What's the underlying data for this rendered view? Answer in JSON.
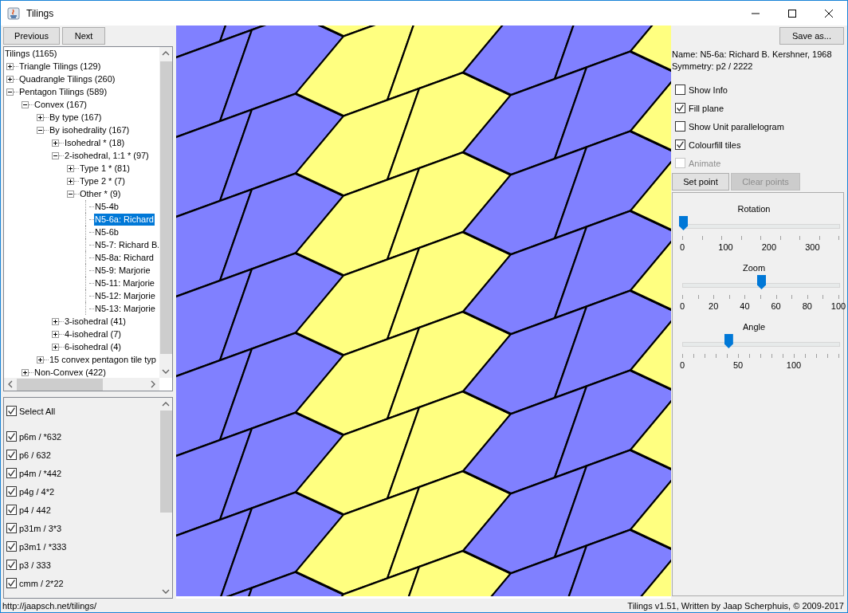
{
  "window": {
    "title": "Tilings"
  },
  "nav_buttons": [
    "Previous",
    "Next"
  ],
  "tree": {
    "root": "Tilings (1165)",
    "items": [
      {
        "label": "Triangle Tilings (129)",
        "expanded": false,
        "selected": false
      },
      {
        "label": "Quadrangle Tilings (260)",
        "expanded": false,
        "selected": false
      },
      {
        "label": "Pentagon Tilings (589)",
        "expanded": true,
        "selected": false,
        "children": [
          {
            "label": "Convex (167)",
            "expanded": true,
            "selected": false,
            "children": [
              {
                "label": "By type (167)",
                "expanded": false,
                "selected": false
              },
              {
                "label": "By isohedrality (167)",
                "expanded": true,
                "selected": false,
                "children": [
                  {
                    "label": "Isohedral * (18)",
                    "expanded": false,
                    "selected": false
                  },
                  {
                    "label": "2-isohedral, 1:1 * (97)",
                    "expanded": true,
                    "selected": false,
                    "children": [
                      {
                        "label": "Type 1 * (81)",
                        "expanded": false,
                        "selected": false
                      },
                      {
                        "label": "Type 2 * (7)",
                        "expanded": false,
                        "selected": false
                      },
                      {
                        "label": "Other * (9)",
                        "expanded": true,
                        "selected": false,
                        "children": [
                          {
                            "label": "N5-4b",
                            "selected": false
                          },
                          {
                            "label": "N5-6a: Richard",
                            "selected": true
                          },
                          {
                            "label": "N5-6b",
                            "selected": false
                          },
                          {
                            "label": "N5-7: Richard B.",
                            "selected": false
                          },
                          {
                            "label": "N5-8a: Richard",
                            "selected": false
                          },
                          {
                            "label": "N5-9: Marjorie",
                            "selected": false
                          },
                          {
                            "label": "N5-11: Marjorie",
                            "selected": false
                          },
                          {
                            "label": "N5-12: Marjorie",
                            "selected": false
                          },
                          {
                            "label": "N5-13: Marjorie",
                            "selected": false
                          }
                        ]
                      }
                    ]
                  },
                  {
                    "label": "3-isohedral (41)",
                    "expanded": false,
                    "selected": false
                  },
                  {
                    "label": "4-isohedral (7)",
                    "expanded": false,
                    "selected": false
                  },
                  {
                    "label": "6-isohedral (4)",
                    "expanded": false,
                    "selected": false
                  }
                ]
              },
              {
                "label": "15 convex pentagon tile typ",
                "expanded": false,
                "selected": false
              }
            ]
          },
          {
            "label": "Non-Convex (422)",
            "expanded": false,
            "selected": false
          }
        ]
      }
    ]
  },
  "symmetry_list": {
    "select_all": {
      "label": "Select All",
      "checked": true
    },
    "items": [
      {
        "label": "p6m / *632",
        "checked": true
      },
      {
        "label": "p6 / 632",
        "checked": true
      },
      {
        "label": "p4m / *442",
        "checked": true
      },
      {
        "label": "p4g / 4*2",
        "checked": true
      },
      {
        "label": "p4 / 442",
        "checked": true
      },
      {
        "label": "p31m / 3*3",
        "checked": true
      },
      {
        "label": "p3m1 / *333",
        "checked": true
      },
      {
        "label": "p3 / 333",
        "checked": true
      },
      {
        "label": "cmm / 2*22",
        "checked": true
      }
    ]
  },
  "save_button": "Save as...",
  "info": [
    "Name: N5-6a: Richard B. Kershner, 1968",
    "Symmetry: p2 / 2222"
  ],
  "options": [
    {
      "label": "Show Info",
      "checked": false,
      "disabled": false
    },
    {
      "label": "Fill plane",
      "checked": true,
      "disabled": false
    },
    {
      "label": "Show Unit parallelogram",
      "checked": false,
      "disabled": false
    },
    {
      "label": "Colourfill tiles",
      "checked": true,
      "disabled": false
    },
    {
      "label": "Animate",
      "checked": false,
      "disabled": true
    }
  ],
  "point_buttons": [
    {
      "label": "Set point",
      "disabled": false
    },
    {
      "label": "Clear points",
      "disabled": true
    }
  ],
  "sliders": [
    {
      "label": "Rotation",
      "level": 0,
      "tick_labels": [
        "0",
        "100",
        "200",
        "300"
      ]
    },
    {
      "label": "Zoom",
      "level": 0.5,
      "tick_labels": [
        "0",
        "20",
        "40",
        "60",
        "80",
        "100"
      ]
    },
    {
      "label": "Angle",
      "level": 0.29,
      "tick_labels": [
        "0",
        "50",
        "100"
      ]
    }
  ],
  "status_bar": {
    "left": "http://jaapsch.net/tilings/",
    "right": "Tilings v1.51, Written by Jaap Scherphuis, © 2009-2017"
  }
}
